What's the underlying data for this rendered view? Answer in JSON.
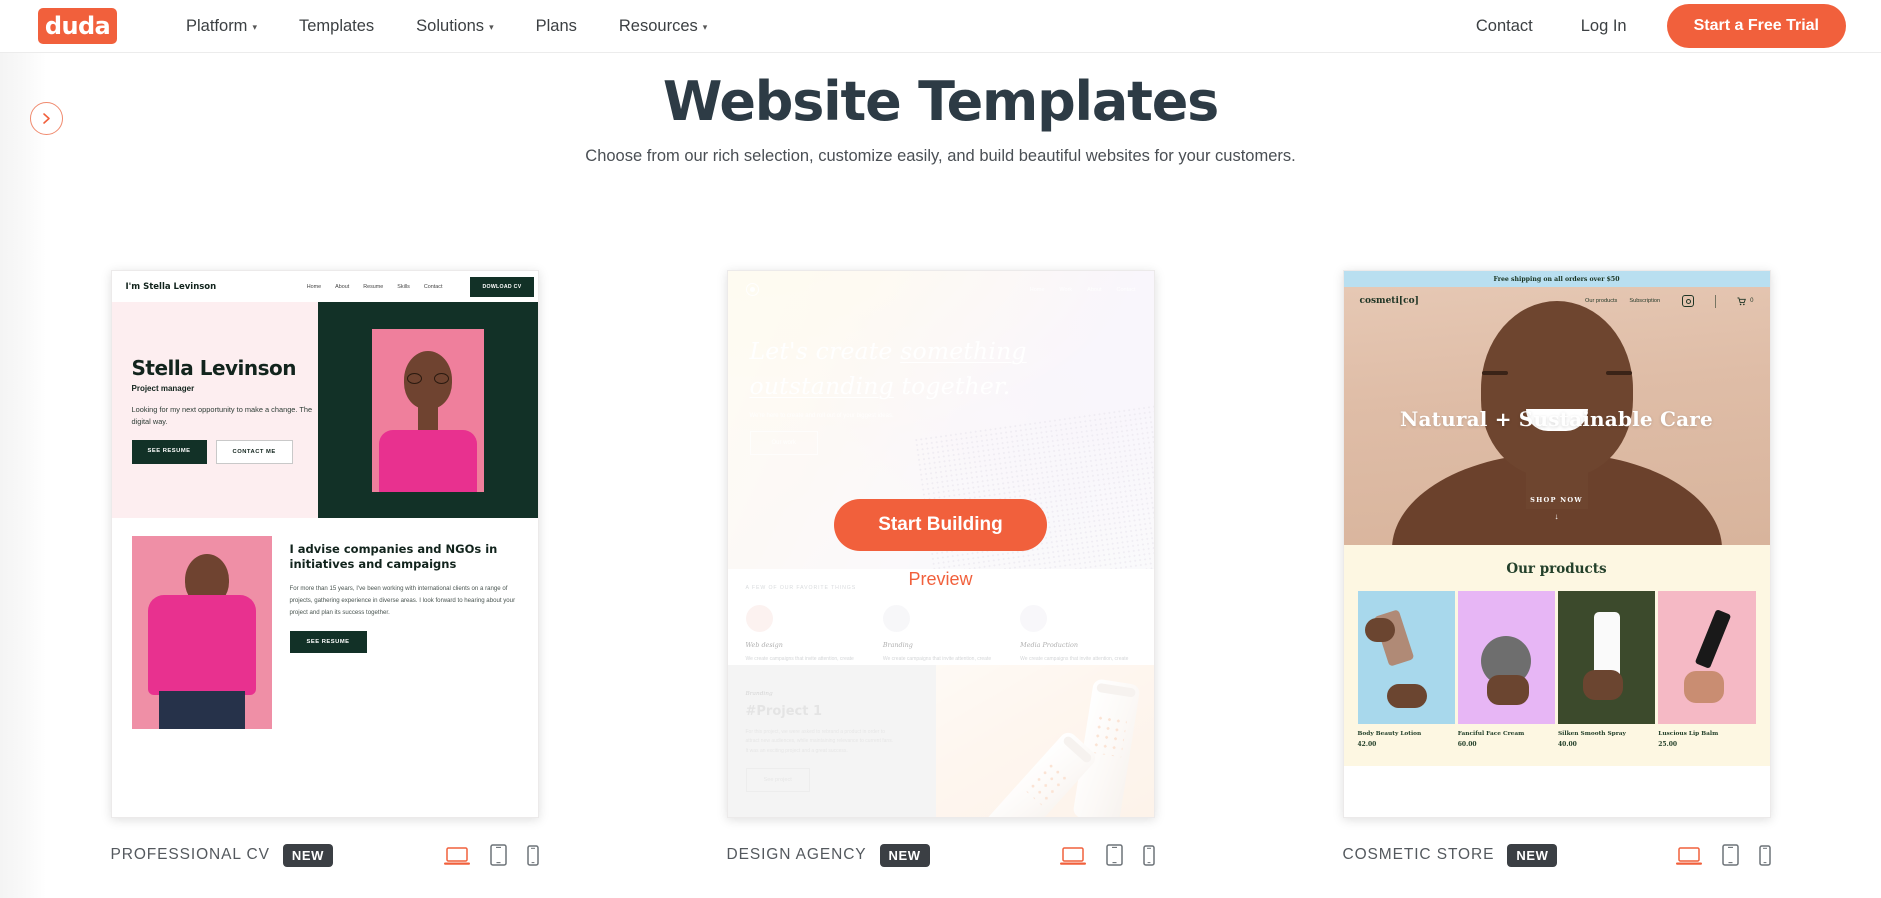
{
  "header": {
    "logo_text": "duda",
    "nav": [
      {
        "label": "Platform",
        "has_caret": true
      },
      {
        "label": "Templates",
        "has_caret": false
      },
      {
        "label": "Solutions",
        "has_caret": true
      },
      {
        "label": "Plans",
        "has_caret": false
      },
      {
        "label": "Resources",
        "has_caret": true
      }
    ],
    "contact_label": "Contact",
    "login_label": "Log In",
    "cta_label": "Start a Free Trial"
  },
  "sidebar_toggle": {
    "icon": "chevron-right-icon"
  },
  "page": {
    "title": "Website Templates",
    "subtitle": "Choose from our rich selection, customize easily, and build beautiful websites for your customers."
  },
  "colors": {
    "accent": "#f1603c",
    "title": "#2d3b45",
    "badge_bg": "#3b3f44",
    "device_active": "#f1603c",
    "device_inactive": "#6d7378"
  },
  "overlay": {
    "start_building_label": "Start Building",
    "preview_label": "Preview"
  },
  "devices": [
    {
      "name": "desktop",
      "label": "Desktop",
      "active": true
    },
    {
      "name": "tablet",
      "label": "Tablet",
      "active": false
    },
    {
      "name": "mobile",
      "label": "Mobile",
      "active": false
    }
  ],
  "templates": [
    {
      "name": "PROFESSIONAL CV",
      "badge": "NEW",
      "hovered": false,
      "preview": {
        "brand": "I'm Stella Levinson",
        "nav": [
          "Home",
          "About",
          "Resume",
          "Skills",
          "Contact"
        ],
        "nav_cta": "DOWLOAD CV",
        "hero_name": "Stella Levinson",
        "hero_role": "Project manager",
        "hero_text": "Looking for my next opportunity to make a change. The digital way.",
        "hero_btn1": "SEE RESUME",
        "hero_btn2": "CONTACT ME",
        "section_heading": "I advise companies and NGOs in initiatives and campaigns",
        "section_text": "For more than 15 years, I've been working with international clients on a range of projects, gathering experience in diverse areas. I look forward to hearing about your project and plan its success together.",
        "section_btn": "SEE RESUME"
      }
    },
    {
      "name": "DESIGN AGENCY",
      "badge": "NEW",
      "hovered": true,
      "preview": {
        "nav": [
          "Home",
          "Work",
          "About",
          "Contact"
        ],
        "hero_line1_a": "Let's create ",
        "hero_line1_b": "something",
        "hero_line2_a": "outstanding",
        "hero_line2_b": " together.",
        "hero_sub": "We're here to create and roll out of your biggest ideas.",
        "hero_btn": "Our work",
        "kicker": "A FEW OF OUR FAVORITE THINGS",
        "services": [
          {
            "name": "Web design",
            "text": "We create campaigns that invite attention, create buzz, and convert audiences. Tell us what you need and we'll bring it to life."
          },
          {
            "name": "Branding",
            "text": "We create campaigns that invite attention, create buzz, and convert audiences. Tell us what you need and we'll bring it to life."
          },
          {
            "name": "Media Production",
            "text": "We create campaigns that invite attention, create buzz, and convert audiences. Tell us what you need and we'll bring it to life."
          }
        ],
        "project_category": "Branding",
        "project_title": "#Project 1",
        "project_text": "For this project, we were asked to rebrand a product in order to attract new audiences, while maintaining relevance to current fans. It was an exciting project and a great success.",
        "project_btn": "See project"
      }
    },
    {
      "name": "COSMETIC STORE",
      "badge": "NEW",
      "hovered": false,
      "preview": {
        "shipping_bar": "Free shipping on all orders over $50",
        "brand": "cosmeti[co]",
        "nav": [
          "Our products",
          "Subscription"
        ],
        "cart_count": "0",
        "hero_heading": "Natural + Sustainable Care",
        "shop_now": "SHOP NOW",
        "products_heading": "Our products",
        "products": [
          {
            "name": "Body Beauty Lotion",
            "price": "42.00"
          },
          {
            "name": "Fanciful Face Cream",
            "price": "60.00"
          },
          {
            "name": "Silken Smooth Spray",
            "price": "40.00"
          },
          {
            "name": "Luscious Lip Balm",
            "price": "25.00"
          }
        ]
      }
    }
  ]
}
